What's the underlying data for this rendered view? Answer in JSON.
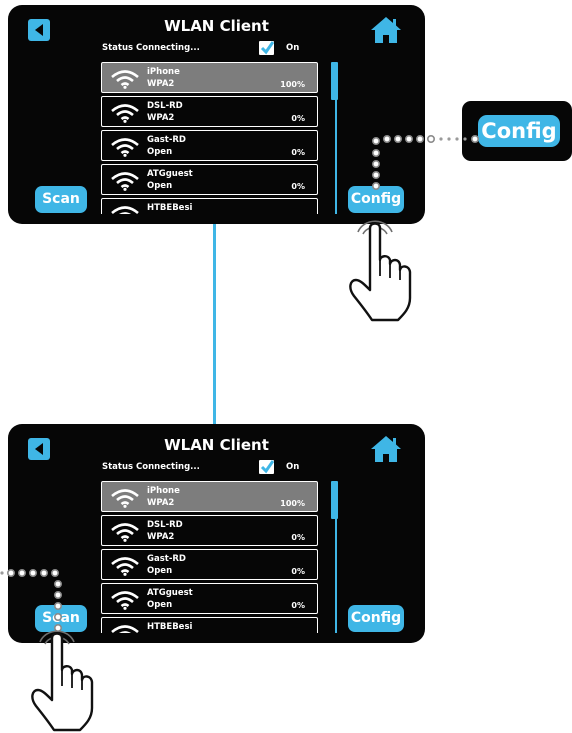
{
  "screens": [
    {
      "title": "WLAN Client",
      "status_label": "Status Connecting...",
      "checkbox_label": "On",
      "scan_label": "Scan",
      "config_label": "Config",
      "networks": [
        {
          "ssid": "iPhone",
          "security": "WPA2",
          "signal": "100%"
        },
        {
          "ssid": "DSL-RD",
          "security": "WPA2",
          "signal": "0%"
        },
        {
          "ssid": "Gast-RD",
          "security": "Open",
          "signal": "0%"
        },
        {
          "ssid": "ATGguest",
          "security": "Open",
          "signal": "0%"
        },
        {
          "ssid": "HTBEBesi",
          "security": "",
          "signal": ""
        }
      ]
    },
    {
      "title": "WLAN Client",
      "status_label": "Status Connecting...",
      "checkbox_label": "On",
      "scan_label": "Scan",
      "config_label": "Config",
      "networks": [
        {
          "ssid": "iPhone",
          "security": "WPA2",
          "signal": "100%"
        },
        {
          "ssid": "DSL-RD",
          "security": "WPA2",
          "signal": "0%"
        },
        {
          "ssid": "Gast-RD",
          "security": "Open",
          "signal": "0%"
        },
        {
          "ssid": "ATGguest",
          "security": "Open",
          "signal": "0%"
        },
        {
          "ssid": "HTBEBesi",
          "security": "",
          "signal": ""
        }
      ]
    }
  ],
  "callout": {
    "label": "Config"
  },
  "icons": {
    "back": "back-arrow-icon",
    "home": "home-icon",
    "checkbox": "checkmark-icon",
    "network": "wifi-icon",
    "hand": "hand-pointer-icon"
  },
  "colors": {
    "accent": "#3fb6e6",
    "screen_bg": "#060606",
    "selected_row": "#7d7d7d"
  }
}
